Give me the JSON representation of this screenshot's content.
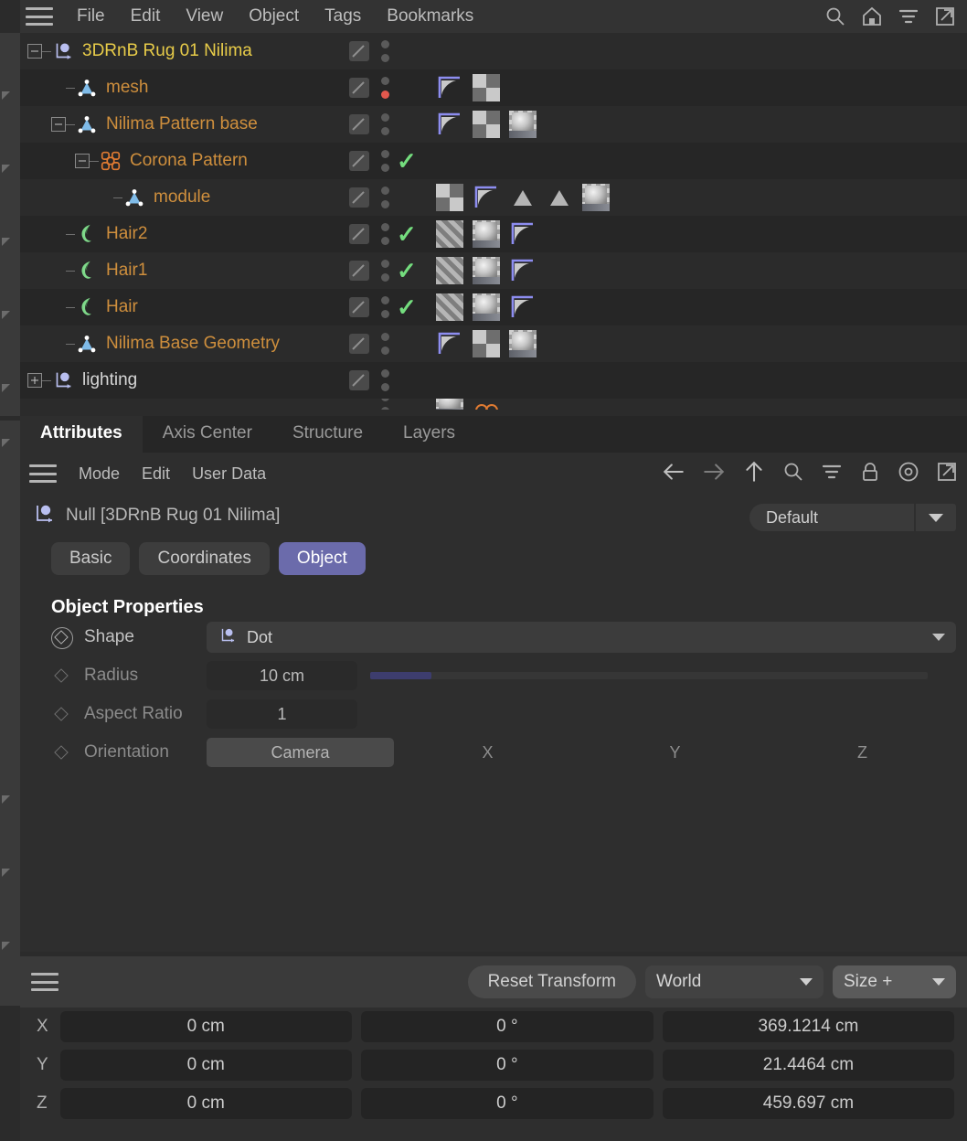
{
  "menubar": {
    "hamburger": "menu-icon",
    "items": [
      "File",
      "Edit",
      "View",
      "Object",
      "Tags",
      "Bookmarks"
    ],
    "icons": [
      "search-icon",
      "home-icon",
      "filter-icon",
      "external-link-icon"
    ]
  },
  "object_manager": {
    "rows": [
      {
        "name": "3DRnB Rug 01 Nilima",
        "icon": "null-object-icon",
        "color": "yellow",
        "depth": 0,
        "expander": "minus",
        "dots": [
          "gray",
          "gray"
        ],
        "visible_check": false,
        "tags": []
      },
      {
        "name": "mesh",
        "icon": "polygon-object-icon",
        "color": "orange",
        "depth": 1,
        "expander": "none",
        "dots": [
          "gray",
          "red"
        ],
        "visible_check": false,
        "tags": [
          "phong-tag",
          "checker-tag"
        ]
      },
      {
        "name": "Nilima Pattern base",
        "icon": "polygon-object-icon",
        "color": "orange",
        "depth": 1,
        "expander": "minus",
        "dots": [
          "gray",
          "gray"
        ],
        "visible_check": false,
        "tags": [
          "phong-tag",
          "checker-tag",
          "material-tag"
        ]
      },
      {
        "name": "Corona Pattern",
        "icon": "corona-pattern-icon",
        "color": "orange",
        "depth": 2,
        "expander": "minus",
        "dots": [
          "gray",
          "gray"
        ],
        "visible_check": true,
        "tags": []
      },
      {
        "name": "module",
        "icon": "polygon-object-icon",
        "color": "orange",
        "depth": 3,
        "expander": "none",
        "dots": [
          "gray",
          "gray"
        ],
        "visible_check": false,
        "tags": [
          "checker-tag",
          "phong-tag",
          "selection-tag",
          "selection-tag",
          "material-tag"
        ]
      },
      {
        "name": "Hair2",
        "icon": "hair-object-icon",
        "color": "orange",
        "depth": 1,
        "expander": "none",
        "dots": [
          "gray",
          "gray"
        ],
        "visible_check": true,
        "tags": [
          "stripes-tag",
          "material-tag",
          "phong-tag"
        ]
      },
      {
        "name": "Hair1",
        "icon": "hair-object-icon",
        "color": "orange",
        "depth": 1,
        "expander": "none",
        "dots": [
          "gray",
          "gray"
        ],
        "visible_check": true,
        "tags": [
          "stripes-tag",
          "material-tag",
          "phong-tag"
        ]
      },
      {
        "name": "Hair",
        "icon": "hair-object-icon",
        "color": "orange",
        "depth": 1,
        "expander": "none",
        "dots": [
          "gray",
          "gray"
        ],
        "visible_check": true,
        "tags": [
          "stripes-tag",
          "material-tag",
          "phong-tag"
        ]
      },
      {
        "name": "Nilima Base Geometry",
        "icon": "polygon-object-icon",
        "color": "orange",
        "depth": 1,
        "expander": "none",
        "dots": [
          "gray",
          "gray"
        ],
        "visible_check": false,
        "tags": [
          "phong-tag",
          "checker-tag",
          "material-tag"
        ]
      },
      {
        "name": "lighting",
        "icon": "null-object-icon",
        "color": "white",
        "depth": 0,
        "expander": "plus",
        "dots": [
          "gray",
          "gray"
        ],
        "visible_check": false,
        "tags": []
      }
    ]
  },
  "attribute_manager": {
    "tabs": [
      "Attributes",
      "Axis Center",
      "Structure",
      "Layers"
    ],
    "active_tab": "Attributes",
    "menu": {
      "hamburger": "menu-icon",
      "items": [
        "Mode",
        "Edit",
        "User Data"
      ],
      "icons": [
        "back-arrow-icon",
        "forward-arrow-icon",
        "up-arrow-icon",
        "search-icon",
        "filter-icon",
        "lock-icon",
        "target-icon",
        "external-link-icon"
      ]
    },
    "object_header": {
      "icon": "null-object-icon",
      "title": "Null [3DRnB Rug 01 Nilima]"
    },
    "preset": {
      "value": "Default",
      "caret": "chevron-down-icon"
    },
    "pills": [
      "Basic",
      "Coordinates",
      "Object"
    ],
    "active_pill": "Object",
    "section_title": "Object Properties",
    "properties": {
      "shape": {
        "label": "Shape",
        "value": "Dot",
        "icon": "null-object-icon",
        "keyframe": "keyframe-ring-icon"
      },
      "radius": {
        "label": "Radius",
        "value": "10 cm",
        "slider_percent": 11,
        "keyframe": "keyframe-icon"
      },
      "aspect_ratio": {
        "label": "Aspect Ratio",
        "value": "1",
        "keyframe": "keyframe-icon"
      },
      "orientation": {
        "label": "Orientation",
        "options": [
          "Camera",
          "X",
          "Y",
          "Z"
        ],
        "selected": "Camera",
        "keyframe": "keyframe-icon"
      }
    }
  },
  "coordinates": {
    "hamburger": "menu-icon",
    "reset_label": "Reset Transform",
    "space": "World",
    "mode": "Size +",
    "axes": [
      "X",
      "Y",
      "Z"
    ],
    "position": [
      "0 cm",
      "0 cm",
      "0 cm"
    ],
    "rotation": [
      "0 °",
      "0 °",
      "0 °"
    ],
    "size": [
      "369.1214 cm",
      "21.4464 cm",
      "459.697 cm"
    ]
  },
  "colors": {
    "accent": "#6b6bab",
    "selected_object": "#e8cc49",
    "object_text": "#cf8f3d",
    "check_green": "#74dd7e",
    "alert_red": "#e2584d"
  }
}
